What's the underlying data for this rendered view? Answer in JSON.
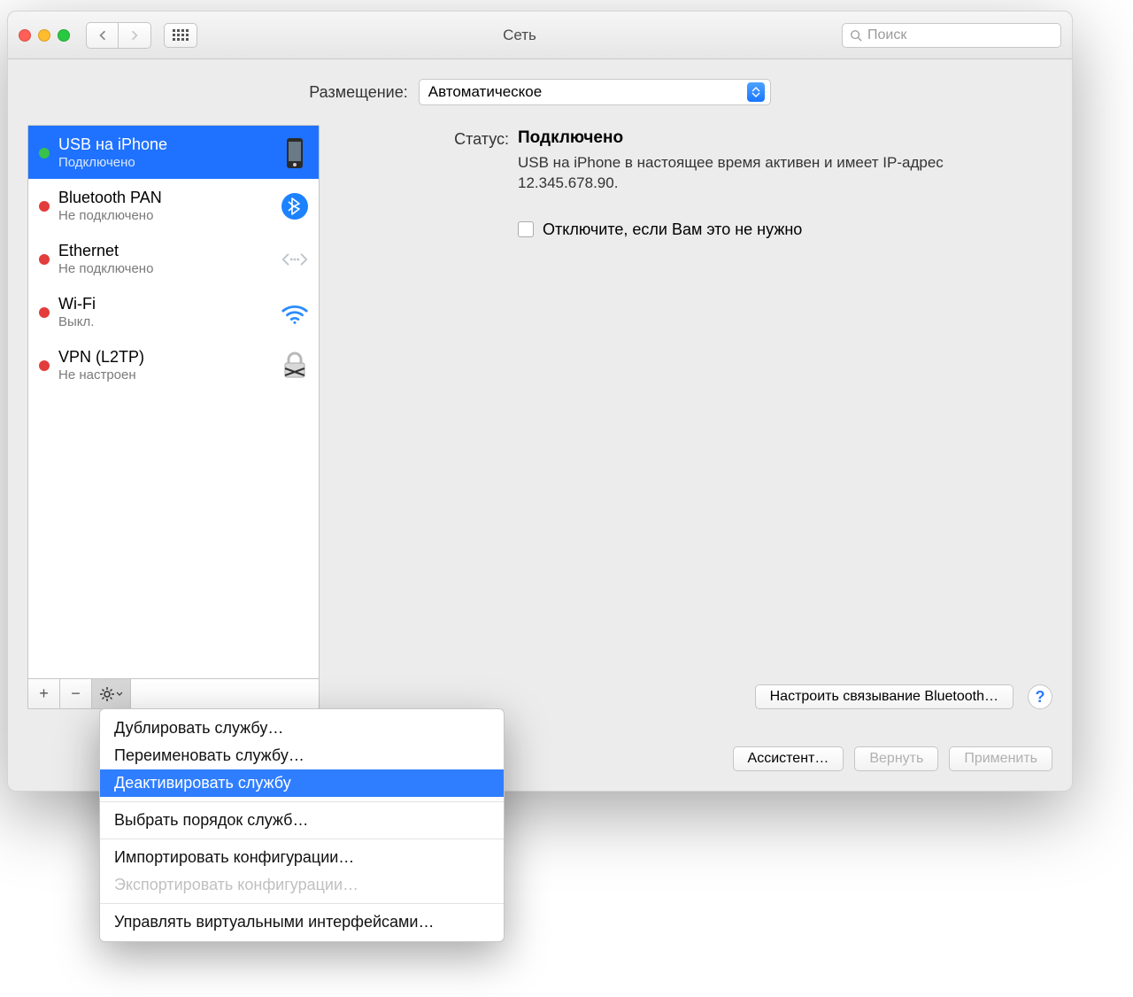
{
  "window": {
    "title": "Сеть"
  },
  "search": {
    "placeholder": "Поиск"
  },
  "location": {
    "label": "Размещение:",
    "value": "Автоматическое"
  },
  "services": [
    {
      "name": "USB на iPhone",
      "status": "Подключено",
      "dot": "green",
      "selected": true
    },
    {
      "name": "Bluetooth PAN",
      "status": "Не подключено",
      "dot": "red",
      "selected": false
    },
    {
      "name": "Ethernet",
      "status": "Не подключено",
      "dot": "red",
      "selected": false
    },
    {
      "name": "Wi-Fi",
      "status": "Выкл.",
      "dot": "red",
      "selected": false
    },
    {
      "name": "VPN (L2TP)",
      "status": "Не настроен",
      "dot": "red",
      "selected": false
    }
  ],
  "detail": {
    "status_label": "Статус:",
    "status_value": "Подключено",
    "status_desc": "USB на iPhone в настоящее время активен и имеет IP-адрес 12.345.678.90.",
    "checkbox_label": "Отключите, если Вам это не нужно",
    "configure_button": "Настроить связывание Bluetooth…"
  },
  "buttons": {
    "assistant": "Ассистент…",
    "revert": "Вернуть",
    "apply": "Применить"
  },
  "context_menu": {
    "items": [
      {
        "label": "Дублировать службу…",
        "disabled": false
      },
      {
        "label": "Переименовать службу…",
        "disabled": false
      },
      {
        "label": "Деактивировать службу",
        "disabled": false,
        "selected": true
      },
      {
        "sep": true
      },
      {
        "label": "Выбрать порядок служб…",
        "disabled": false
      },
      {
        "sep": true
      },
      {
        "label": "Импортировать конфигурации…",
        "disabled": false
      },
      {
        "label": "Экспортировать конфигурации…",
        "disabled": true
      },
      {
        "sep": true
      },
      {
        "label": "Управлять виртуальными интерфейсами…",
        "disabled": false
      }
    ]
  }
}
